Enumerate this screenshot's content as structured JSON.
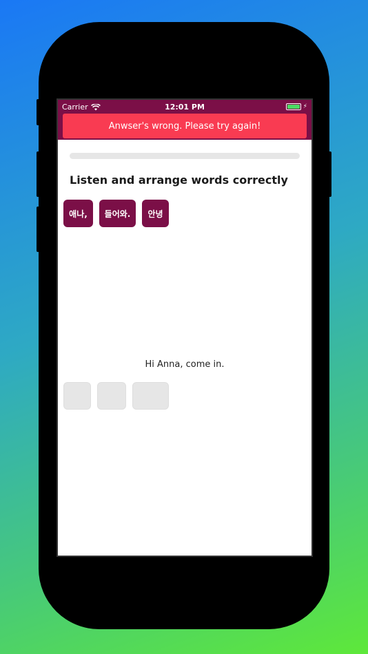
{
  "status_bar": {
    "carrier": "Carrier",
    "time": "12:01 PM",
    "battery_percent": 100
  },
  "banner": {
    "message": "Anwser's wrong. Please try again!",
    "color": "#f93b52"
  },
  "progress": {
    "fraction": 0.0
  },
  "exercise": {
    "title": "Listen and arrange words correctly",
    "words": [
      "애나,",
      "들어와.",
      "안녕"
    ],
    "translation": "Hi Anna, come in.",
    "answer_slots": 3
  },
  "colors": {
    "accent": "#7b0f47",
    "slot": "#e6e6e6"
  },
  "icons": {
    "wifi": "wifi-icon",
    "battery": "battery-icon",
    "charging": "bolt-icon"
  }
}
